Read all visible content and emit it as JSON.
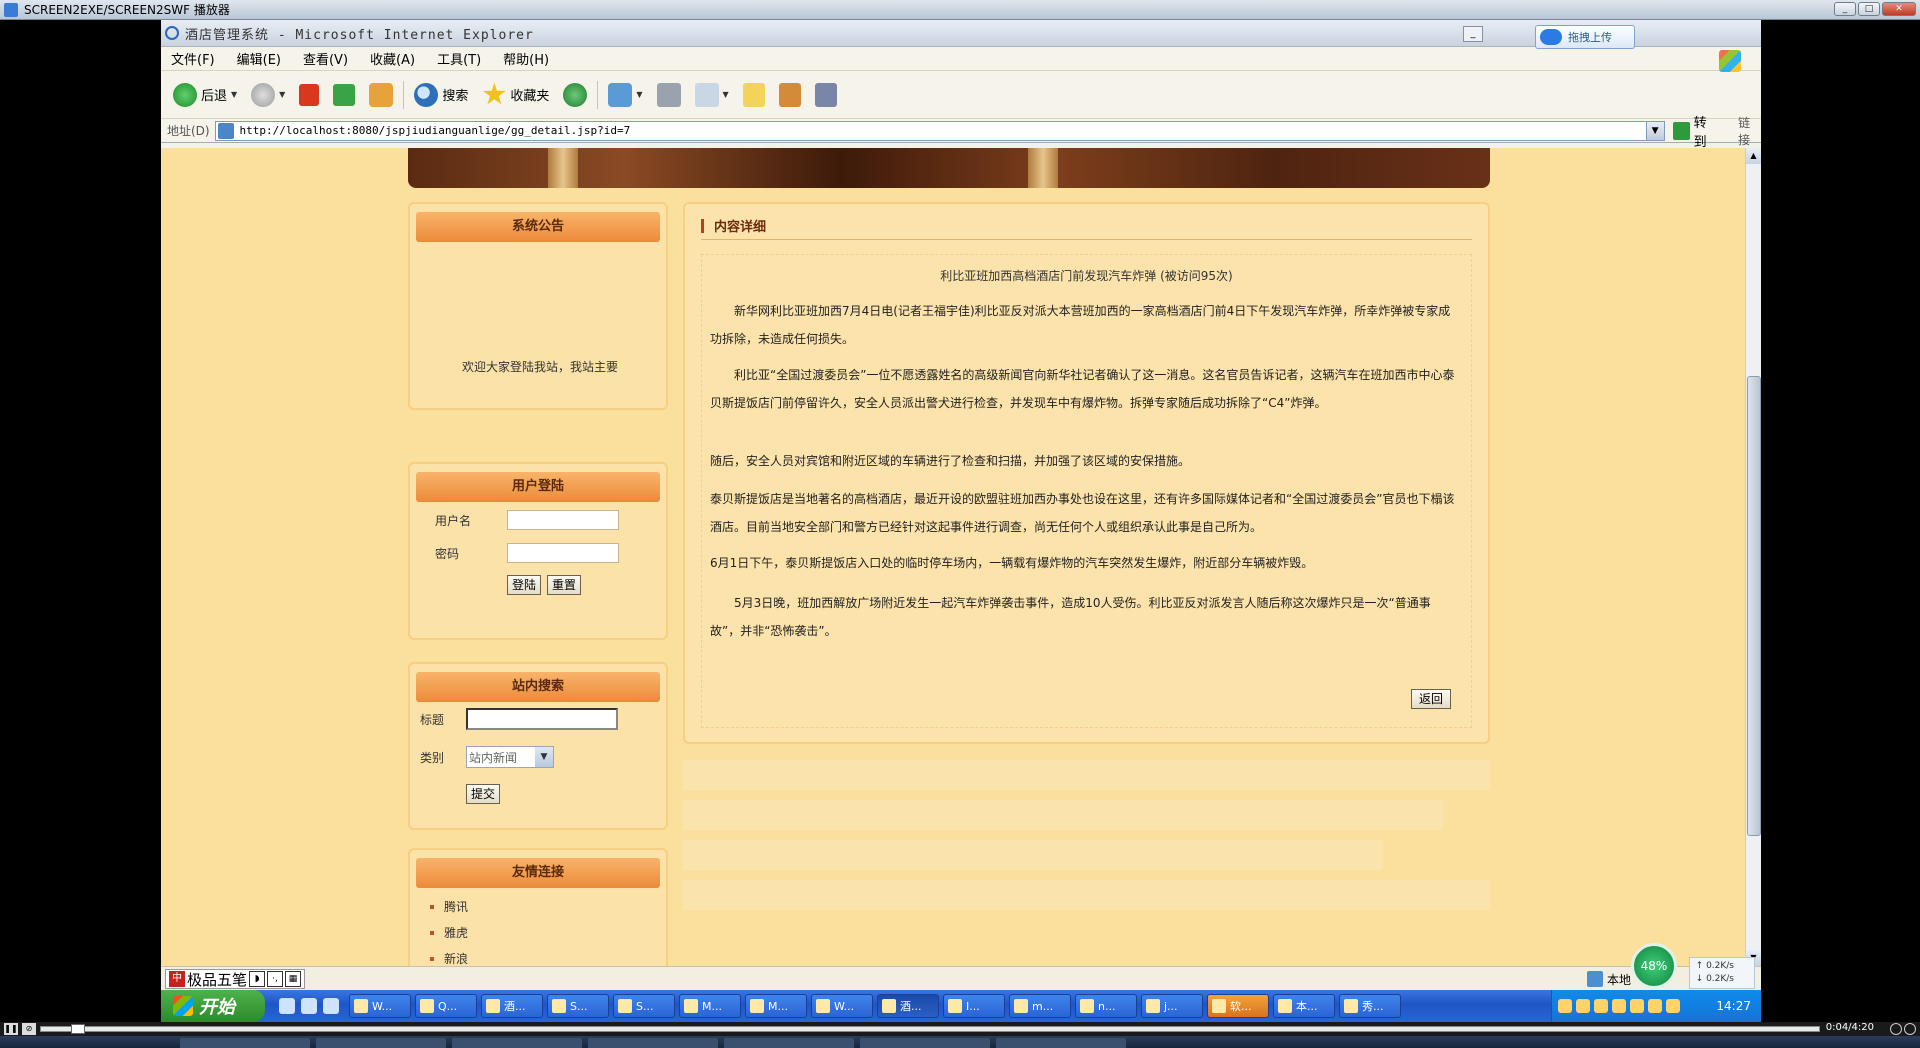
{
  "player": {
    "title": "SCREEN2EXE/SCREEN2SWF 播放器",
    "time": "0:04/4:20"
  },
  "ie": {
    "title": "酒店管理系统 - Microsoft Internet Explorer",
    "upload_label": "拖拽上传",
    "menu": [
      "文件(F)",
      "编辑(E)",
      "查看(V)",
      "收藏(A)",
      "工具(T)",
      "帮助(H)"
    ],
    "toolbar": {
      "back": "后退",
      "search": "搜索",
      "favorites": "收藏夹"
    },
    "address": {
      "label": "地址(D)",
      "url": "http://localhost:8080/jspjiudianguanlige/gg_detail.jsp?id=7",
      "go": "转到",
      "links": "链接"
    }
  },
  "sidebar": {
    "notice": {
      "title": "系统公告",
      "text": "欢迎大家登陆我站，我站主要"
    },
    "login": {
      "title": "用户登陆",
      "username_label": "用户名",
      "password_label": "密码",
      "submit": "登陆",
      "reset": "重置"
    },
    "search": {
      "title": "站内搜索",
      "title_label": "标题",
      "category_label": "类别",
      "category_value": "站内新闻",
      "submit": "提交"
    },
    "links": {
      "title": "友情连接",
      "items": [
        "腾讯",
        "雅虎",
        "新浪"
      ]
    }
  },
  "content": {
    "heading": "内容详细",
    "article_title": "利比亚班加西高档酒店门前发现汽车炸弹 (被访问95次)",
    "paragraphs": [
      "新华网利比亚班加西7月4日电(记者王福宇佳)利比亚反对派大本营班加西的一家高档酒店门前4日下午发现汽车炸弹，所幸炸弹被专家成功拆除，未造成任何损失。",
      "利比亚“全国过渡委员会”一位不愿透露姓名的高级新闻官向新华社记者确认了这一消息。这名官员告诉记者，这辆汽车在班加西市中心泰贝斯提饭店门前停留许久，安全人员派出警犬进行检查，并发现车中有爆炸物。拆弹专家随后成功拆除了“C4”炸弹。",
      "随后，安全人员对宾馆和附近区域的车辆进行了检查和扫描，并加强了该区域的安保措施。",
      "泰贝斯提饭店是当地著名的高档酒店，最近开设的欧盟驻班加西办事处也设在这里，还有许多国际媒体记者和“全国过渡委员会”官员也下榻该酒店。目前当地安全部门和警方已经针对这起事件进行调查，尚无任何个人或组织承认此事是自己所为。",
      "6月1日下午，泰贝斯提饭店入口处的临时停车场内，一辆载有爆炸物的汽车突然发生爆炸，附近部分车辆被炸毁。",
      "5月3日晚，班加西解放广场附近发生一起汽车炸弹袭击事件，造成10人受伤。利比亚反对派发言人随后称这次爆炸只是一次“普通事故”，并非“恐怖袭击”。"
    ],
    "back": "返回"
  },
  "status": {
    "ime_name": "极品五笔",
    "zone": "本地",
    "speed_percent": "48%",
    "up_speed": "0.2K/s",
    "down_speed": "0.2K/s"
  },
  "taskbar": {
    "start": "开始",
    "tasks": [
      "W...",
      "Q...",
      "酒...",
      "S...",
      "S...",
      "M...",
      "M...",
      "W...",
      "酒...",
      "I...",
      "m...",
      "n...",
      "j...",
      "软...",
      "本...",
      "秀..."
    ],
    "clock": "14:27"
  }
}
